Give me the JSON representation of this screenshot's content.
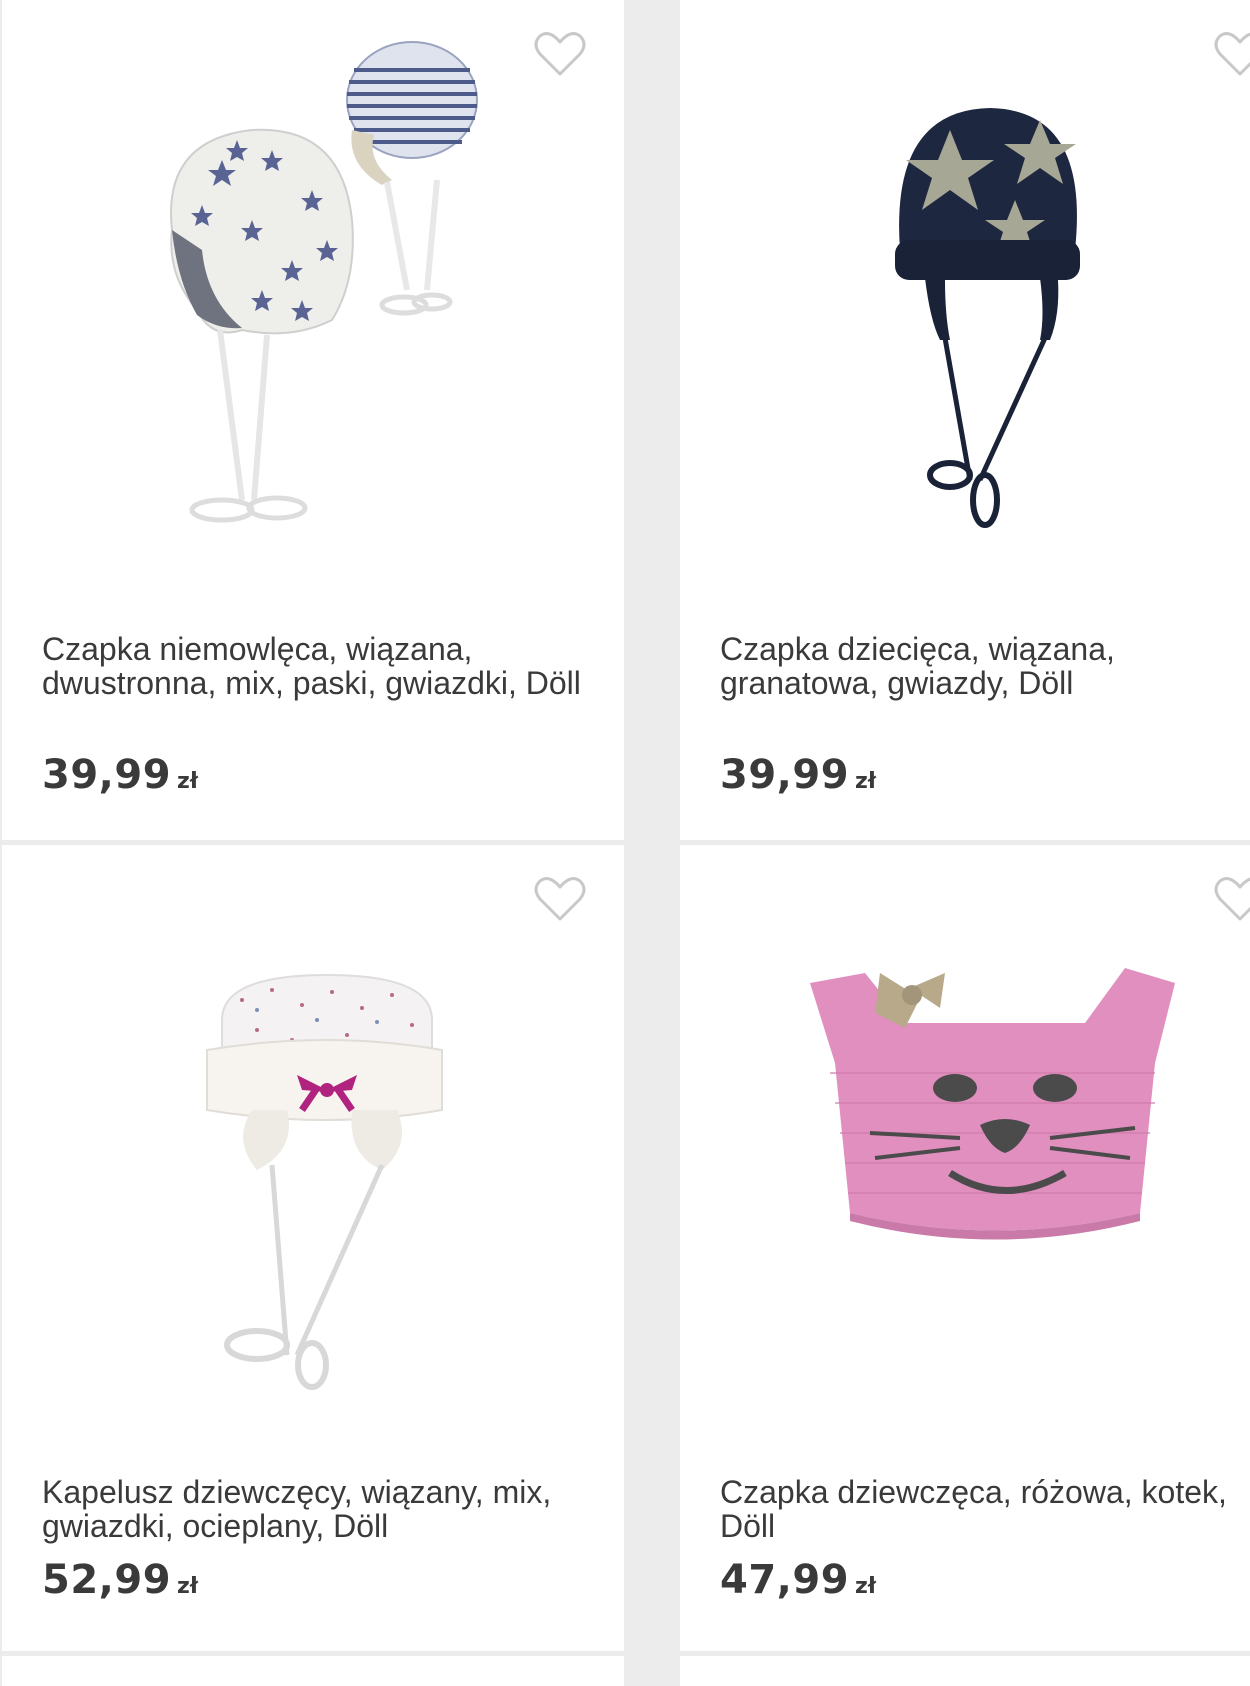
{
  "products": [
    {
      "title": "Czapka niemowlęca, wiązana, dwustronna, mix, paski, gwiazdki, Döll",
      "price": "39,99",
      "currency": "zł",
      "favorite_icon": "heart-outline-icon"
    },
    {
      "title": "Czapka dziecięca, wiązana, granatowa, gwiazdy, Döll",
      "price": "39,99",
      "currency": "zł",
      "favorite_icon": "heart-outline-icon"
    },
    {
      "title": "Kapelusz dziewczęcy, wiązany, mix, gwiazdki, ocieplany, Döll",
      "price": "52,99",
      "currency": "zł",
      "favorite_icon": "heart-outline-icon"
    },
    {
      "title": "Czapka dziewczęca, różowa, kotek, Döll",
      "price": "47,99",
      "currency": "zł",
      "favorite_icon": "heart-outline-icon"
    }
  ],
  "colors": {
    "background": "#ececec",
    "card": "#ffffff",
    "text": "#3a3a3a",
    "heart": "#c8c8c8"
  }
}
